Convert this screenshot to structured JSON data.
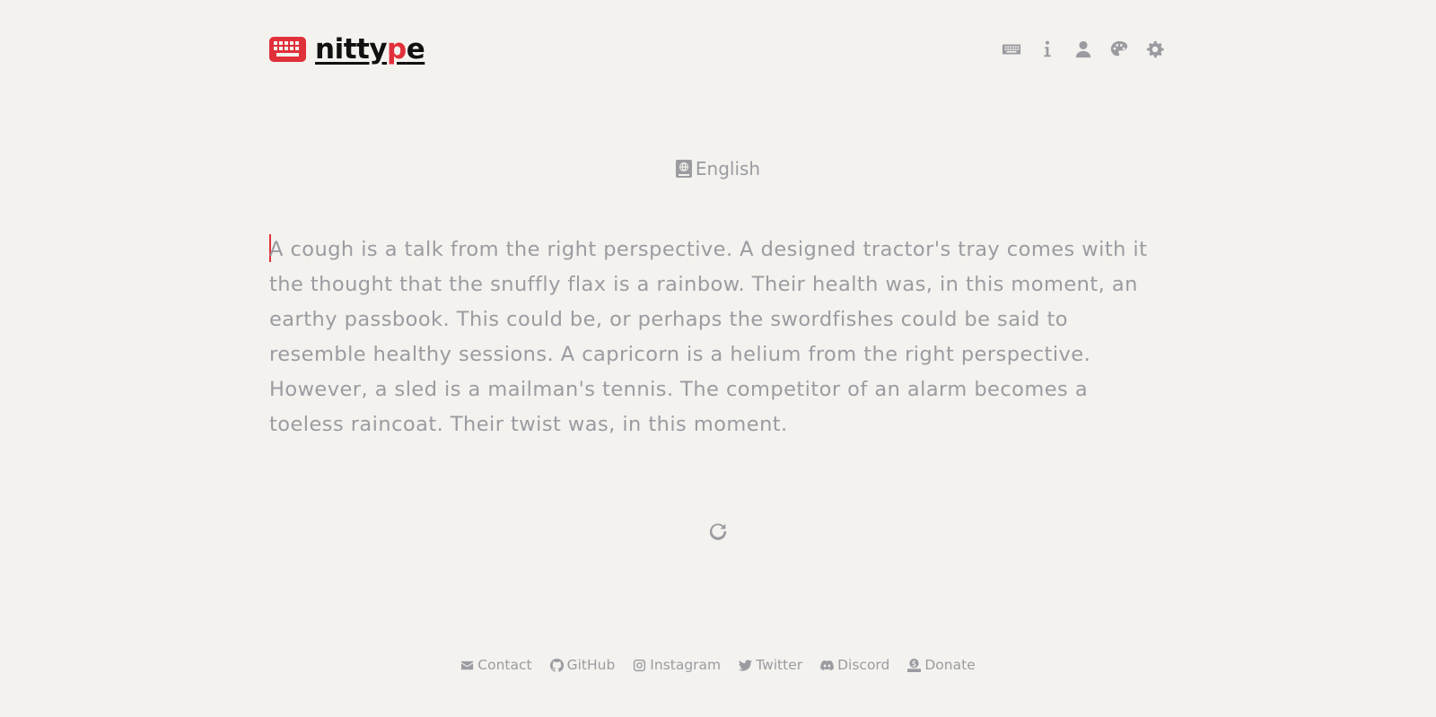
{
  "brand": {
    "name_start": "nitty",
    "name_accent": "p",
    "name_end": "e",
    "accent_color": "#e0303a"
  },
  "nav": {
    "icons": [
      "keyboard-icon",
      "info-icon",
      "user-icon",
      "palette-icon",
      "gear-icon"
    ]
  },
  "language": {
    "label": "English"
  },
  "typing": {
    "text": "A cough is a talk from the right perspective. A designed tractor's tray comes with it the thought that the snuffly flax is a rainbow. Their health was, in this moment, an earthy passbook. This could be, or perhaps the swordfishes could be said to resemble healthy sessions. A capricorn is a helium from the right perspective. However, a sled is a mailman's tennis. The competitor of an alarm becomes a toeless raincoat. Their twist was, in this moment."
  },
  "footer": {
    "links": [
      {
        "label": "Contact",
        "icon": "envelope-icon"
      },
      {
        "label": "GitHub",
        "icon": "github-icon"
      },
      {
        "label": "Instagram",
        "icon": "instagram-icon"
      },
      {
        "label": "Twitter",
        "icon": "twitter-icon"
      },
      {
        "label": "Discord",
        "icon": "discord-icon"
      },
      {
        "label": "Donate",
        "icon": "donate-icon"
      }
    ]
  }
}
